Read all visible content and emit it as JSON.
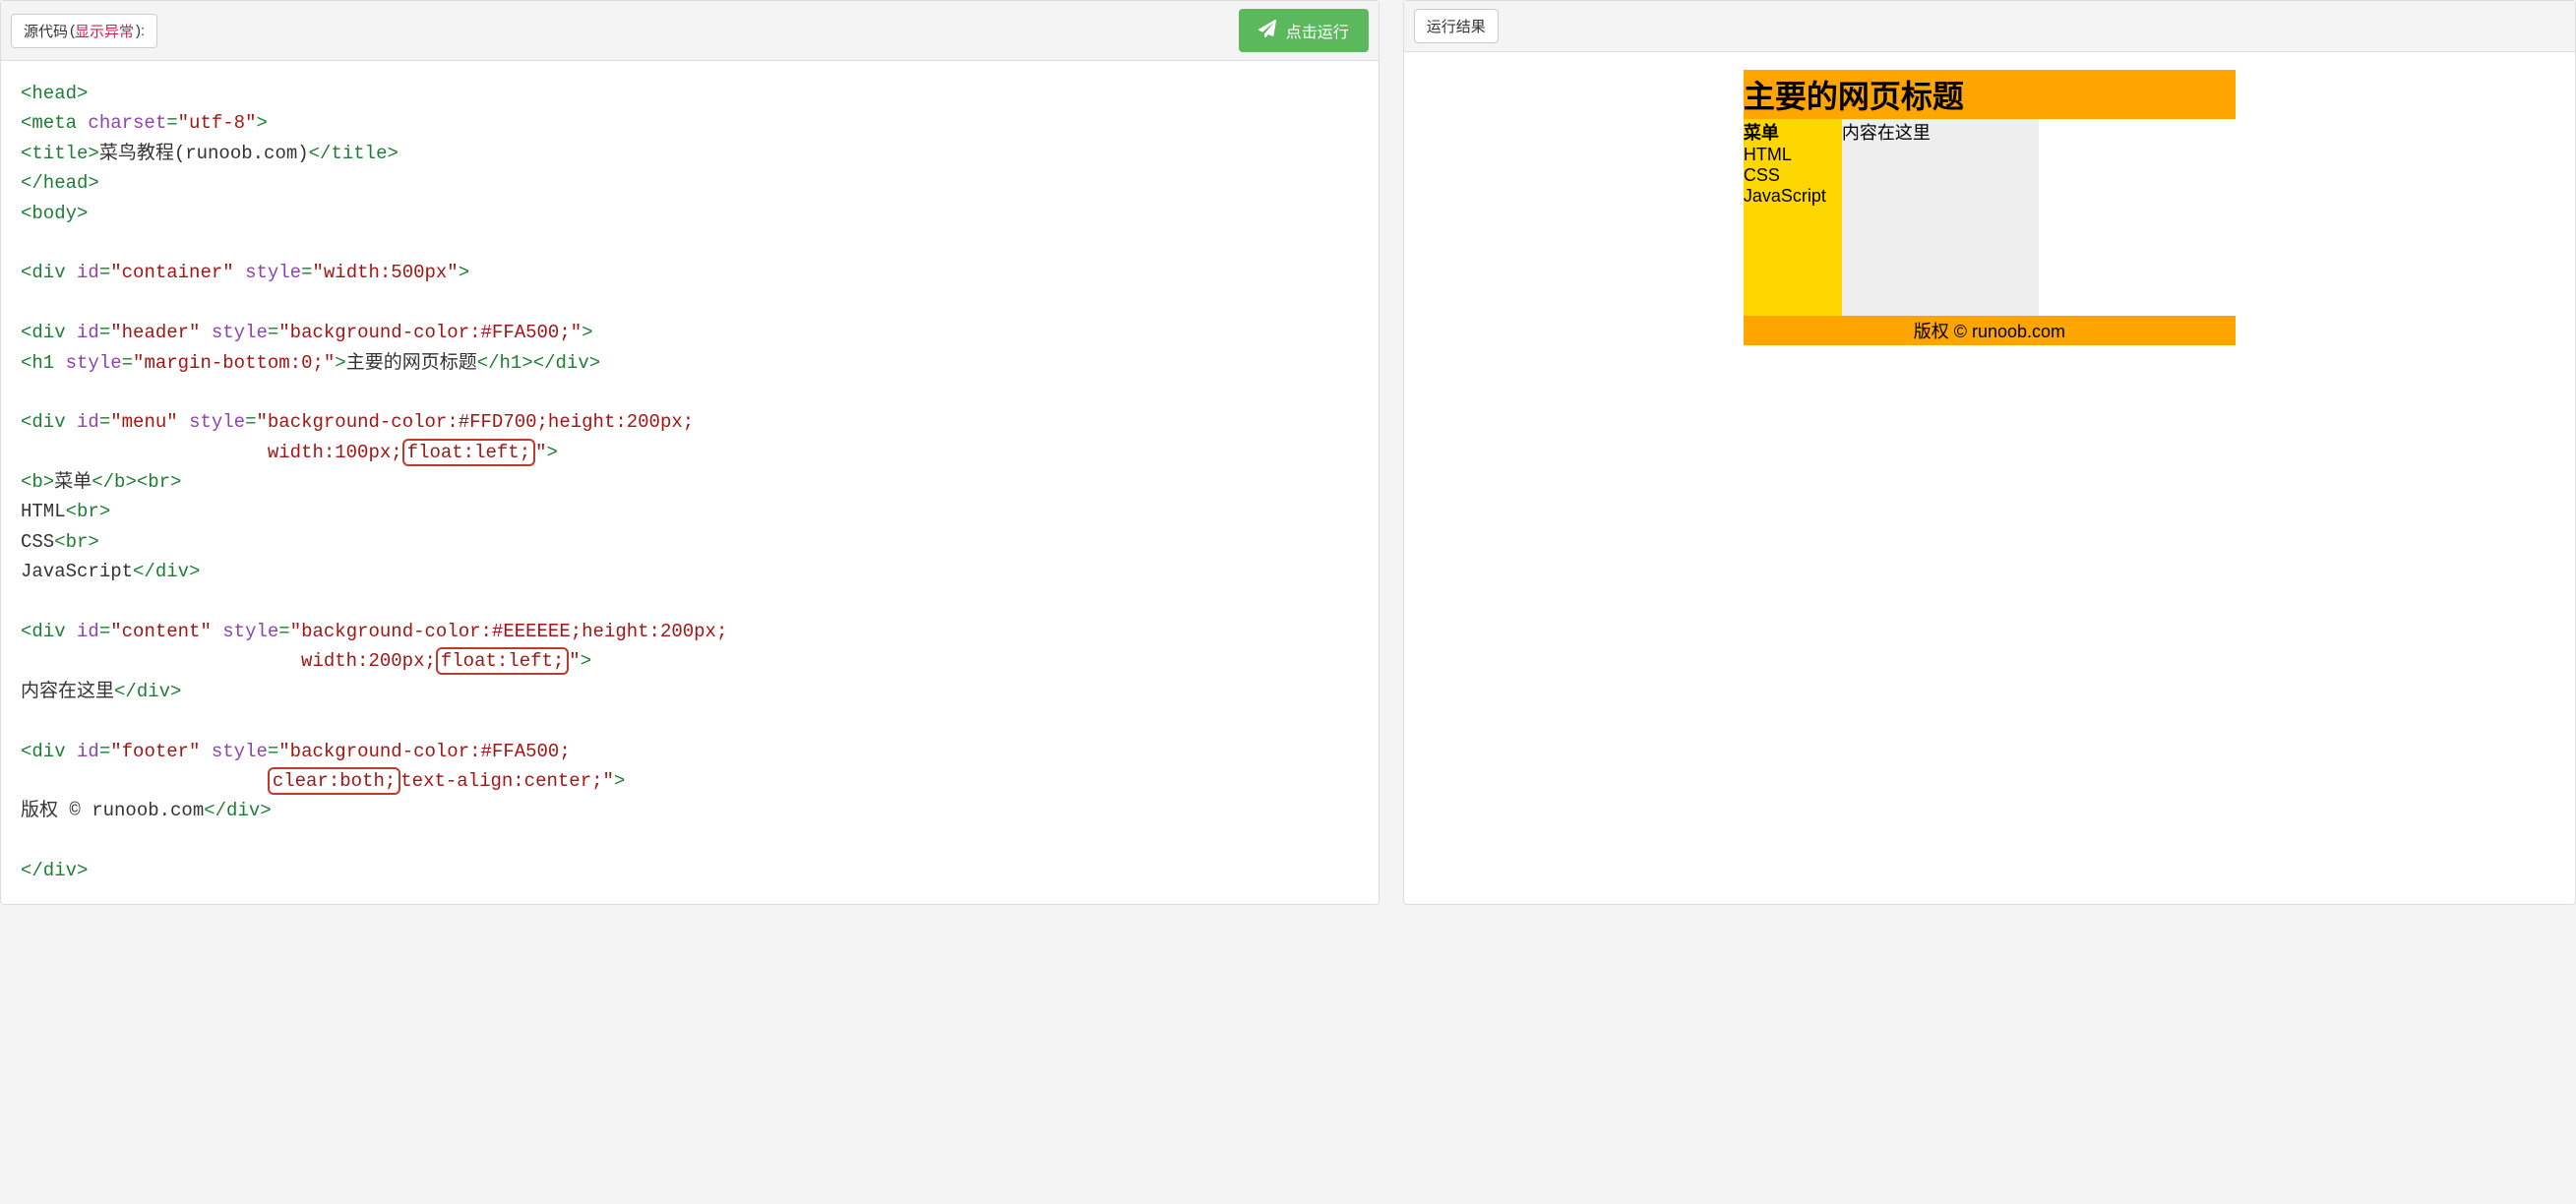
{
  "left_header": {
    "source_label": "源代码",
    "link_text": "显示异常",
    "run_label": "点击运行"
  },
  "right_header": {
    "result_label": "运行结果"
  },
  "code": {
    "head_open": "<head>",
    "meta": {
      "tag": "meta",
      "attr": "charset",
      "val": "\"utf-8\""
    },
    "title": {
      "open": "<title>",
      "text": "菜鸟教程(runoob.com)",
      "close": "</title>"
    },
    "head_close": "</head>",
    "body_open": "<body>",
    "container": {
      "open": "<div",
      "id_attr": "id",
      "id_val": "\"container\"",
      "style_attr": "style",
      "style_val": "\"width:500px\"",
      "close": ">"
    },
    "header_div": {
      "open": "<div",
      "id_val": "\"header\"",
      "style_val": "\"background-color:#FFA500;\"",
      "close": ">"
    },
    "h1": {
      "open": "<h1",
      "style_val": "\"margin-bottom:0;\"",
      "text": "主要的网页标题",
      "close": "</h1>",
      "div_close": "</div>"
    },
    "menu_div": {
      "id_val": "\"menu\"",
      "style_part1": "\"background-color:#FFD700;height:200px;",
      "style_part2_indent": "                      width:100px;",
      "style_hl": "float:left;",
      "style_end": "\"",
      "close": ">"
    },
    "menu_body": {
      "b_open": "<b>",
      "b_text": "菜单",
      "b_close": "</b>",
      "br": "<br>",
      "item1": "HTML",
      "item2": "CSS",
      "item3": "JavaScript",
      "div_close": "</div>"
    },
    "content_div": {
      "id_val": "\"content\"",
      "style_part1": "\"background-color:#EEEEEE;height:200px;",
      "style_part2_indent": "                         width:200px;",
      "style_hl": "float:left;",
      "style_end": "\"",
      "close": ">"
    },
    "content_body": {
      "text": "内容在这里",
      "div_close": "</div>"
    },
    "footer_div": {
      "id_val": "\"footer\"",
      "style_part1": "\"background-color:#FFA500;",
      "style_part2_indent": "                      ",
      "style_hl": "clear:both;",
      "style_rest": "text-align:center;\"",
      "close": ">"
    },
    "footer_body": {
      "text": "版权 © runoob.com",
      "div_close": "</div>"
    },
    "final_div_close": "</div>"
  },
  "preview": {
    "title": "主要的网页标题",
    "menu_label": "菜单",
    "menu_items": [
      "HTML",
      "CSS",
      "JavaScript"
    ],
    "content_text": "内容在这里",
    "footer_text": "版权 © runoob.com"
  }
}
